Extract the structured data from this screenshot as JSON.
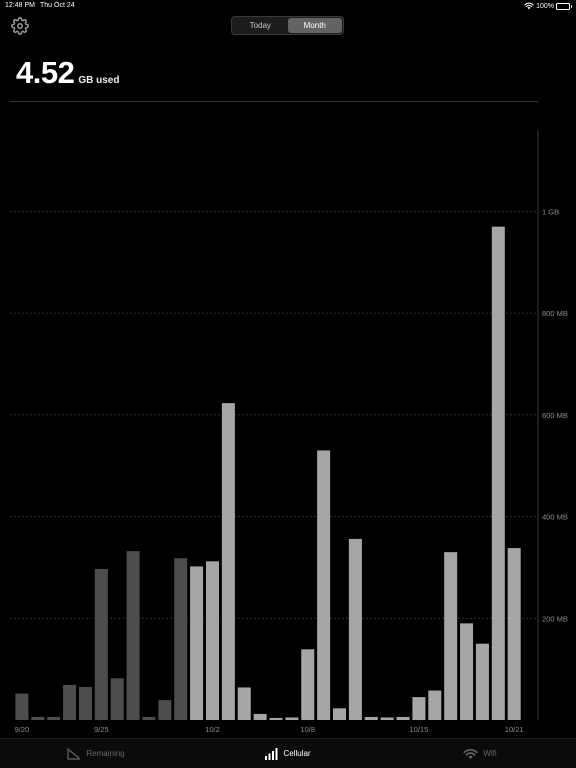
{
  "status": {
    "time": "12:48 PM",
    "date": "Thu Oct 24",
    "battery": "100%"
  },
  "segments": [
    {
      "label": "Today",
      "active": false
    },
    {
      "label": "Month",
      "active": true
    }
  ],
  "usage": {
    "value": "4.52",
    "unit": "GB used"
  },
  "colors": {
    "bar_past": "#4d4d4d",
    "bar_current": "#a6a6a6",
    "gridline": "#3c3c3c",
    "axis_text": "#8e8e8e"
  },
  "chart_data": {
    "type": "bar",
    "x": [
      "9/20",
      "9/21",
      "9/22",
      "9/23",
      "9/24",
      "9/25",
      "9/26",
      "9/27",
      "9/28",
      "9/29",
      "9/30",
      "10/1",
      "10/2",
      "10/3",
      "10/4",
      "10/5",
      "10/6",
      "10/7",
      "10/8",
      "10/9",
      "10/10",
      "10/11",
      "10/12",
      "10/13",
      "10/14",
      "10/15",
      "10/16",
      "10/17",
      "10/18",
      "10/19",
      "10/20",
      "10/21",
      "10/22"
    ],
    "x_tick_labels": [
      "9/20",
      "9/25",
      "10/2",
      "10/8",
      "10/15",
      "10/21"
    ],
    "series": [
      {
        "values": [
          52,
          6,
          6,
          69,
          65,
          297,
          82,
          332,
          6,
          39,
          318,
          302,
          312,
          623,
          64,
          12,
          4,
          5,
          139,
          530,
          23,
          356,
          6,
          5,
          6,
          45,
          58,
          330,
          190,
          150,
          970,
          338,
          0
        ],
        "period": [
          "past",
          "past",
          "past",
          "past",
          "past",
          "past",
          "past",
          "past",
          "past",
          "past",
          "past",
          "current",
          "current",
          "current",
          "current",
          "current",
          "current",
          "current",
          "current",
          "current",
          "current",
          "current",
          "current",
          "current",
          "current",
          "current",
          "current",
          "current",
          "current",
          "current",
          "current",
          "current",
          "current"
        ]
      }
    ],
    "yunit": "MB",
    "ylim": [
      0,
      1160
    ],
    "yticks": [
      200,
      400,
      600,
      800,
      1000
    ],
    "ytick_labels": [
      "200 MB",
      "400 MB",
      "600 MB",
      "800 MB",
      "1 GB"
    ],
    "grid": true
  },
  "tabs": [
    {
      "label": "Remaining",
      "icon": "remaining-chart-icon",
      "active": false
    },
    {
      "label": "Cellular",
      "icon": "cellular-bars-icon",
      "active": true
    },
    {
      "label": "Wifi",
      "icon": "wifi-icon",
      "active": false
    }
  ]
}
